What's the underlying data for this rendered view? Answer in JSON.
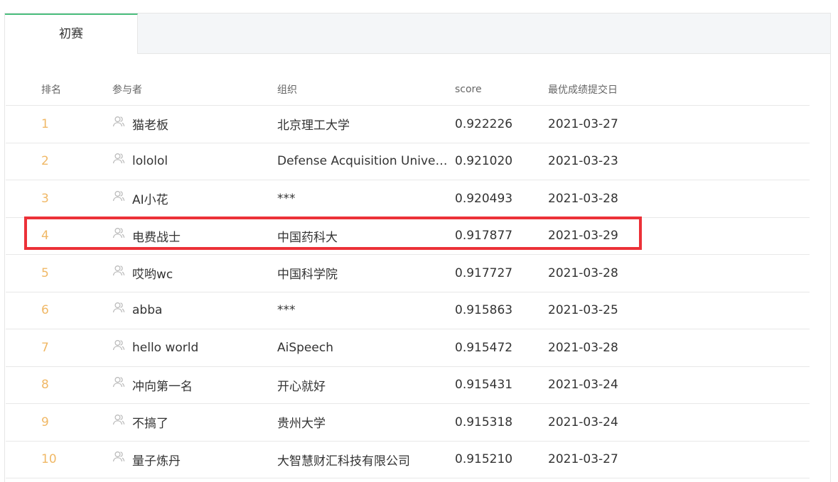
{
  "tabs": [
    {
      "label": "初赛",
      "active": true
    }
  ],
  "columns": {
    "rank": "排名",
    "participant": "参与者",
    "org": "组织",
    "score": "score",
    "date": "最优成绩提交日"
  },
  "rows": [
    {
      "rank": "1",
      "name": "猫老板",
      "org": "北京理工大学",
      "score": "0.922226",
      "date": "2021-03-27"
    },
    {
      "rank": "2",
      "name": "lololol",
      "org": "Defense Acquisition University",
      "score": "0.921020",
      "date": "2021-03-23"
    },
    {
      "rank": "3",
      "name": "AI小花",
      "org": "***",
      "score": "0.920493",
      "date": "2021-03-28"
    },
    {
      "rank": "4",
      "name": "电费战士",
      "org": "中国药科大",
      "score": "0.917877",
      "date": "2021-03-29"
    },
    {
      "rank": "5",
      "name": "哎哟wc",
      "org": "中国科学院",
      "score": "0.917727",
      "date": "2021-03-28"
    },
    {
      "rank": "6",
      "name": "abba",
      "org": "***",
      "score": "0.915863",
      "date": "2021-03-25"
    },
    {
      "rank": "7",
      "name": "hello world",
      "org": "AiSpeech",
      "score": "0.915472",
      "date": "2021-03-28"
    },
    {
      "rank": "8",
      "name": "冲向第一名",
      "org": "开心就好",
      "score": "0.915431",
      "date": "2021-03-24"
    },
    {
      "rank": "9",
      "name": "不搞了",
      "org": "贵州大学",
      "score": "0.915318",
      "date": "2021-03-24"
    },
    {
      "rank": "10",
      "name": "量子炼丹",
      "org": "大智慧财汇科技有限公司",
      "score": "0.915210",
      "date": "2021-03-27"
    }
  ],
  "highlighted_rank": "4",
  "colors": {
    "rank": "#f0b866",
    "tab_accent": "#4cbf7f",
    "highlight_box": "#ec3138"
  },
  "icons": {
    "participant": "user-icon"
  }
}
